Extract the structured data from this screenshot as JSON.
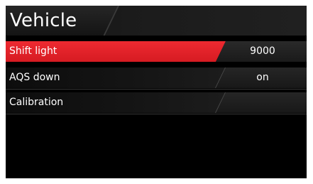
{
  "header": {
    "title": "Vehicle"
  },
  "menu": {
    "items": [
      {
        "label": "Shift light",
        "value": "9000",
        "selected": true
      },
      {
        "label": "AQS down",
        "value": "on",
        "selected": false
      },
      {
        "label": "Calibration",
        "value": "",
        "selected": false
      }
    ]
  },
  "colors": {
    "accent": "#e3222a",
    "background": "#000000",
    "text": "#ffffff"
  }
}
